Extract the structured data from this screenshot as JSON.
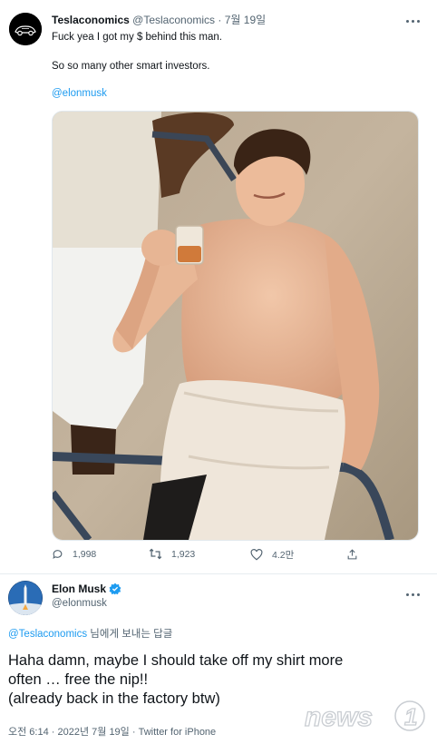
{
  "tweet1": {
    "author_name": "Teslaconomics",
    "author_handle": "@Teslaconomics",
    "date": "7월 19일",
    "separator": " · ",
    "lines": [
      "Fuck yea I got my $ behind this man.",
      "So so many other smart investors.",
      "@elonmusk"
    ],
    "actions": {
      "reply_count": "1,998",
      "retweet_count": "1,923",
      "like_count": "4.2만"
    }
  },
  "tweet2": {
    "author_name": "Elon Musk",
    "author_handle": "@elonmusk",
    "reply_to_handle": "@Teslaconomics",
    "reply_to_suffix": " 님에게 보내는 답글",
    "body_lines": [
      "Haha damn, maybe I should take off my shirt more",
      "often … free the nip!!",
      "(already back in the factory btw)"
    ],
    "time": "오전 6:14",
    "date": "2022년 7월 19일",
    "source": "Twitter for iPhone"
  },
  "watermark": "news1",
  "colors": {
    "link": "#1d9bf0",
    "secondary_text": "#536471",
    "verified": "#1d9bf0"
  }
}
